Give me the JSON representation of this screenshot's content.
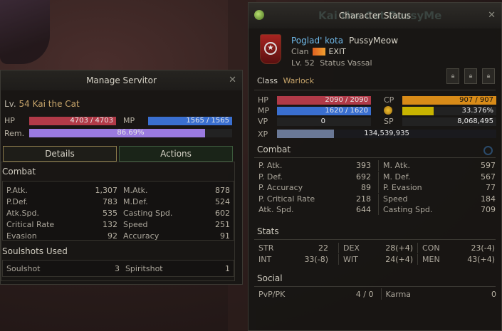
{
  "servitor": {
    "title": "Manage Servitor",
    "level_label": "Lv.",
    "level": "54",
    "name": "Kai the Cat",
    "hp_label": "HP",
    "hp_text": "4703 / 4703",
    "hp_fraction": 1.0,
    "mp_label": "MP",
    "mp_text": "1565 / 1565",
    "mp_fraction": 1.0,
    "rem_label": "Rem.",
    "rem_text": "86.69%",
    "rem_fraction": 0.8669,
    "tabs": [
      "Details",
      "Actions"
    ],
    "combat_header": "Combat",
    "combat": [
      {
        "l1": "P.Atk.",
        "v1": "1,307",
        "l2": "M.Atk.",
        "v2": "878"
      },
      {
        "l1": "P.Def.",
        "v1": "783",
        "l2": "M.Def.",
        "v2": "524"
      },
      {
        "l1": "Atk.Spd.",
        "v1": "535",
        "l2": "Casting Spd.",
        "v2": "602"
      },
      {
        "l1": "Critical Rate",
        "v1": "132",
        "l2": "Speed",
        "v2": "251"
      },
      {
        "l1": "Evasion",
        "v1": "92",
        "l2": "Accuracy",
        "v2": "91"
      }
    ],
    "soulshots_header": "Soulshots Used",
    "soulshot_label": "Soulshot",
    "soulshot_value": "3",
    "spiritshot_label": "Spiritshot",
    "spiritshot_value": "1"
  },
  "character": {
    "title": "Character Status",
    "bg_watermark": "Kai the Cat  PussyMe",
    "name": "Poglad' kota",
    "title_name": "PussyMeow",
    "clan_label": "Clan",
    "clan_name": "EXIT",
    "level_text": "Lv. 52",
    "status_text": "Status Vassal",
    "class_label": "Class",
    "class_value": "Warlock",
    "hp_label": "HP",
    "hp_text": "2090 / 2090",
    "hp_fraction": 1.0,
    "mp_label": "MP",
    "mp_text": "1620 / 1620",
    "mp_fraction": 1.0,
    "vp_label": "VP",
    "vp_text": "0",
    "cp_label": "CP",
    "cp_text": "907 / 907",
    "cp_fraction": 1.0,
    "exp_percent_text": "33.376%",
    "exp_fraction": 0.334,
    "sp_label": "SP",
    "sp_text": "8,068,495",
    "xp_label": "XP",
    "xp_text": "134,539,935",
    "combat_header": "Combat",
    "combat": [
      {
        "l1": "P. Atk.",
        "v1": "393",
        "l2": "M. Atk.",
        "v2": "597"
      },
      {
        "l1": "P. Def.",
        "v1": "692",
        "l2": "M. Def.",
        "v2": "567"
      },
      {
        "l1": "P. Accuracy",
        "v1": "89",
        "l2": "P. Evasion",
        "v2": "77"
      },
      {
        "l1": "P. Critical Rate",
        "v1": "218",
        "l2": "Speed",
        "v2": "184"
      },
      {
        "l1": "Atk. Spd.",
        "v1": "644",
        "l2": "Casting Spd.",
        "v2": "709"
      }
    ],
    "stats_header": "Stats",
    "stats": [
      {
        "l1": "STR",
        "v1": "22",
        "l2": "DEX",
        "v2": "28(+4)",
        "l3": "CON",
        "v3": "23(-4)"
      },
      {
        "l1": "INT",
        "v1": "33(-8)",
        "l2": "WIT",
        "v2": "24(+4)",
        "l3": "MEN",
        "v3": "43(+4)"
      }
    ],
    "social_header": "Social",
    "pvp_label": "PvP/PK",
    "pvp_value": "4 / 0",
    "karma_label": "Karma",
    "karma_value": "0"
  },
  "colors": {
    "hp": "#b13a48",
    "mp": "#3a6fd0",
    "rem": "#9a7ae0",
    "cp": "#d88b18",
    "exp": "#c8b400",
    "xp": "#6a7896",
    "accent_text": "#c9a66b",
    "name_text": "#6fb8e8"
  },
  "icons": [
    "close-icon",
    "clan-crest-icon",
    "warlock-emblem-icon",
    "lock-icon",
    "settings-icon",
    "coin-icon"
  ]
}
